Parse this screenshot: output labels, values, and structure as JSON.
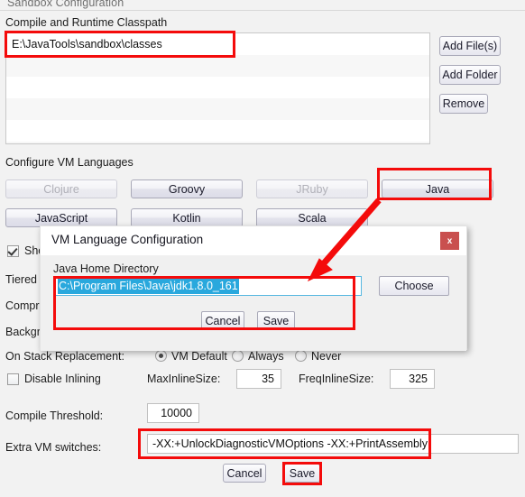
{
  "window": {
    "title": "Sandbox Configuration"
  },
  "classpath": {
    "section_label": "Compile and Runtime Classpath",
    "entries": [
      "E:\\JavaTools\\sandbox\\classes",
      "",
      "",
      "",
      "",
      ""
    ],
    "buttons": {
      "add_files": "Add File(s)",
      "add_folder": "Add Folder",
      "remove": "Remove"
    }
  },
  "vm_languages": {
    "section_label": "Configure VM Languages",
    "buttons": [
      {
        "label": "Clojure",
        "enabled": false
      },
      {
        "label": "Groovy",
        "enabled": true
      },
      {
        "label": "JRuby",
        "enabled": false
      },
      {
        "label": "Java",
        "enabled": true
      },
      {
        "label": "JavaScript",
        "enabled": true
      },
      {
        "label": "Kotlin",
        "enabled": true
      },
      {
        "label": "Scala",
        "enabled": true
      }
    ]
  },
  "options": {
    "show_label": "Sho",
    "tiered_label": "Tiered C",
    "compressed_label": "Compre",
    "background_label": "Backgro",
    "osr_label": "On Stack Replacement:",
    "osr_options": [
      "VM Default",
      "Always",
      "Never"
    ],
    "osr_selected": "VM Default",
    "disable_inlining_label": "Disable Inlining",
    "disable_inlining_checked": false,
    "max_inline_label": "MaxInlineSize:",
    "max_inline_value": "35",
    "freq_inline_label": "FreqInlineSize:",
    "freq_inline_value": "325",
    "compile_threshold_label": "Compile Threshold:",
    "compile_threshold_value": "10000",
    "extra_switches_label": "Extra VM switches:",
    "extra_switches_value": "-XX:+UnlockDiagnosticVMOptions -XX:+PrintAssembly"
  },
  "footer": {
    "cancel": "Cancel",
    "save": "Save"
  },
  "dialog": {
    "title": "VM Language Configuration",
    "close_label": "x",
    "java_home_label": "Java Home Directory",
    "java_home_value": "C:\\Program Files\\Java\\jdk1.8.0_161",
    "choose": "Choose",
    "cancel": "Cancel",
    "save": "Save"
  },
  "annotation": {
    "color": "#f40b0b"
  }
}
